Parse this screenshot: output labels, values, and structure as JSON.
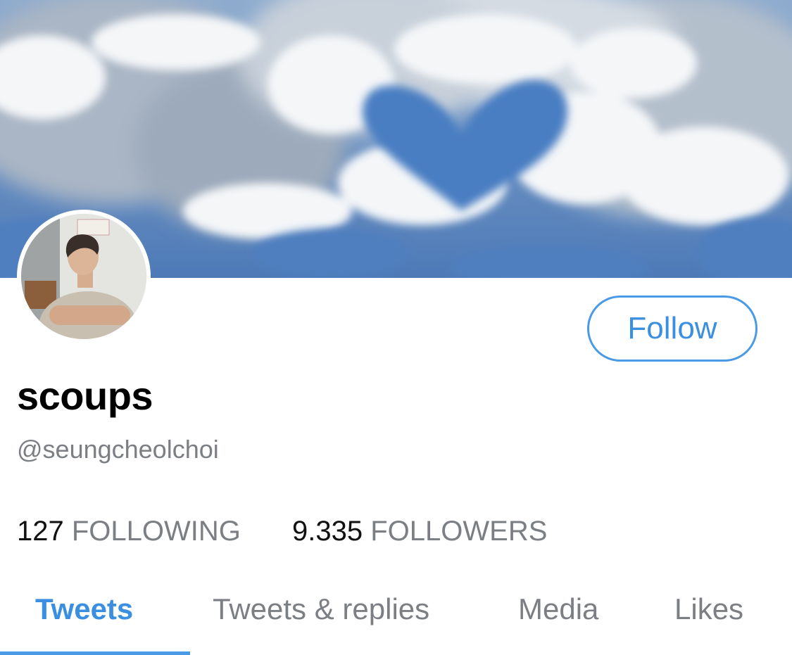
{
  "colors": {
    "accent": "#3b8fe0",
    "text_primary": "#000000",
    "text_secondary": "#7b7f84",
    "sky": "#4f7bb6"
  },
  "banner": {
    "description_icon": "cloud-heart-banner"
  },
  "profile": {
    "display_name": "scoups",
    "handle": "@seungcheolchoi",
    "follow_label": "Follow"
  },
  "stats": {
    "following_count": "127",
    "following_label": "FOLLOWING",
    "followers_count": "9.335",
    "followers_label": "FOLLOWERS"
  },
  "tabs": [
    {
      "label": "Tweets",
      "active": true
    },
    {
      "label": "Tweets & replies",
      "active": false
    },
    {
      "label": "Media",
      "active": false
    },
    {
      "label": "Likes",
      "active": false
    }
  ]
}
